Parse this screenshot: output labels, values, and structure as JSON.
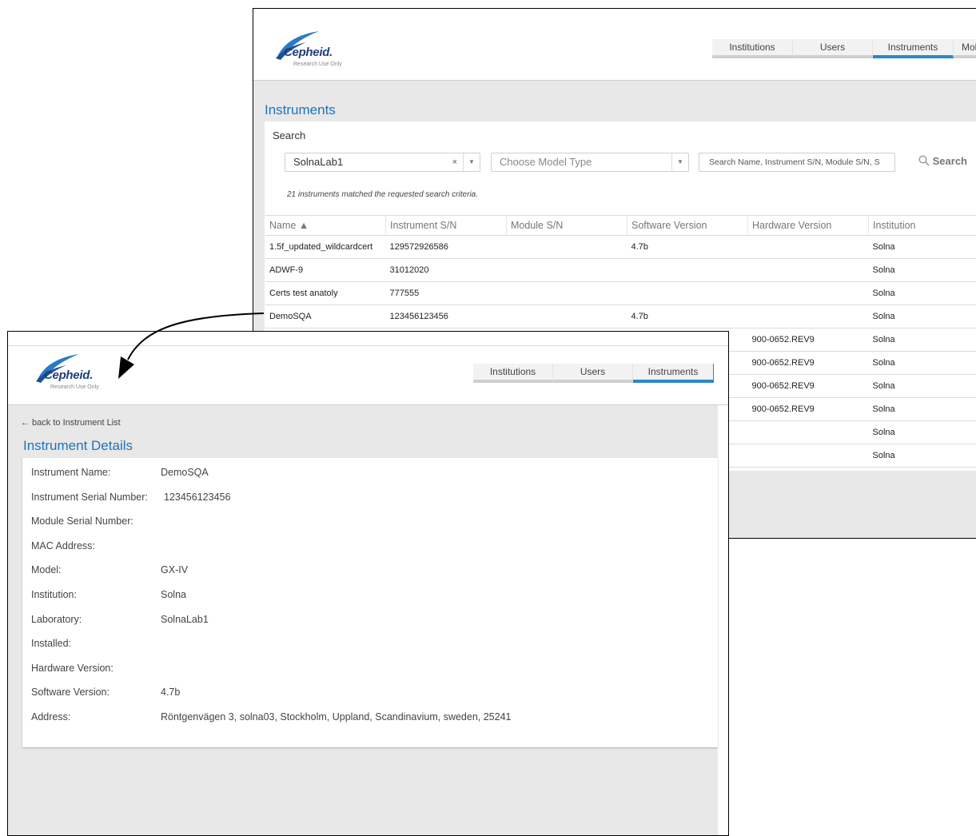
{
  "logo": {
    "brand": "Cepheid.",
    "subtitle": "Research Use Only"
  },
  "back_window": {
    "tabs": [
      {
        "label": "Institutions",
        "active": false
      },
      {
        "label": "Users",
        "active": false
      },
      {
        "label": "Instruments",
        "active": true
      },
      {
        "label": "Mol",
        "active": false
      }
    ],
    "page_title": "Instruments",
    "search_label": "Search",
    "lab_select": {
      "value": "SolnaLab1",
      "clear": "×",
      "arrow": "▼"
    },
    "model_select": {
      "placeholder": "Choose Model Type",
      "arrow": "▼"
    },
    "search_input": {
      "placeholder": "Search Name, Instrument S/N, Module S/N, S"
    },
    "search_button": "Search",
    "matched_text": "21 instruments matched the requested search criteria.",
    "columns": [
      "Name ▲",
      "Instrument S/N",
      "Module S/N",
      "Software Version",
      "Hardware Version",
      "Institution"
    ],
    "rows": [
      [
        "1.5f_updated_wildcardcert",
        "129572926586",
        "",
        "4.7b",
        "",
        "Solna"
      ],
      [
        "ADWF-9",
        "31012020",
        "",
        "",
        "",
        "Solna"
      ],
      [
        "Certs test anatoly",
        "777555",
        "",
        "",
        "",
        "Solna"
      ],
      [
        "DemoSQA",
        "123456123456",
        "",
        "4.7b",
        "",
        "Solna"
      ],
      [
        "",
        "",
        "",
        "",
        "900-0652.REV9",
        "Solna"
      ],
      [
        "",
        "",
        "",
        "",
        "900-0652.REV9",
        "Solna"
      ],
      [
        "",
        "",
        "",
        "",
        "900-0652.REV9",
        "Solna"
      ],
      [
        "",
        "",
        "",
        "",
        "900-0652.REV9",
        "Solna"
      ],
      [
        "",
        "",
        "",
        "",
        "",
        "Solna"
      ],
      [
        "",
        "",
        "",
        "",
        "",
        "Solna"
      ]
    ]
  },
  "front_window": {
    "tabs": [
      {
        "label": "Institutions",
        "active": false
      },
      {
        "label": "Users",
        "active": false
      },
      {
        "label": "Instruments",
        "active": true
      }
    ],
    "back_link": "← back to Instrument List",
    "page_title": "Instrument Details",
    "details": [
      {
        "label": "Instrument Name:",
        "value": "DemoSQA"
      },
      {
        "label": "Instrument Serial Number:",
        "value": "123456123456"
      },
      {
        "label": "Module Serial Number:",
        "value": ""
      },
      {
        "label": "MAC Address:",
        "value": ""
      },
      {
        "label": "Model:",
        "value": "GX-IV"
      },
      {
        "label": "Institution:",
        "value": "Solna"
      },
      {
        "label": "Laboratory:",
        "value": "SolnaLab1"
      },
      {
        "label": "Installed:",
        "value": ""
      },
      {
        "label": "Hardware Version:",
        "value": ""
      },
      {
        "label": "Software Version:",
        "value": "4.7b"
      },
      {
        "label": "Address:",
        "value": "Röntgenvägen 3, solna03, Stockholm, Uppland, Scandinavium, sweden, 25241"
      }
    ]
  },
  "colors": {
    "accent": "#2a87c8",
    "title": "#1e73be",
    "brand": "#1f3f7a",
    "gray_bg": "#e8e8e8"
  }
}
